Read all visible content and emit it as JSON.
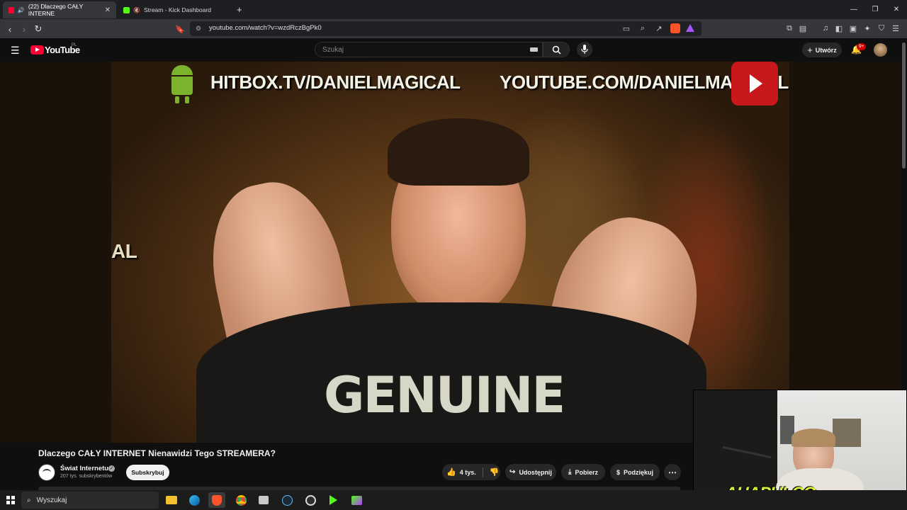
{
  "browser": {
    "tabs": [
      {
        "label": "(22) Dlaczego CAŁY INTERNE",
        "active": true
      },
      {
        "label": "Stream - Kick Dashboard",
        "active": false
      }
    ],
    "url": "youtube.com/watch?v=wzdRczBgPk0"
  },
  "youtube": {
    "logo_text": "YouTube",
    "logo_region": "PL",
    "search_placeholder": "Szukaj",
    "create_label": "Utwórz",
    "notifications_badge": "9+"
  },
  "video_overlay": {
    "left_text": "HITBOX.TV/DANIELMAGICAL",
    "right_text": "YOUTUBE.COM/DANIELMAGICAL",
    "shirt_text": "GENUINE",
    "edge_text": "AL"
  },
  "video_info": {
    "title": "Dlaczego CAŁY INTERNET Nienawidzi Tego STREAMERA?",
    "channel_name": "Świat Internetu",
    "subscribers": "207 tys. subskrybentów",
    "subscribe_label": "Subskrybuj",
    "likes": "4 tys.",
    "share_label": "Udostępnij",
    "download_label": "Pobierz",
    "thanks_label": "Podziękuj"
  },
  "webcam": {
    "overlay_text": "AHAPULCO"
  },
  "taskbar": {
    "search_placeholder": "Wyszukaj"
  },
  "colors": {
    "accent_red": "#ff0033",
    "kick_green": "#53fc18",
    "overlay_yellow": "#d8f03a"
  }
}
